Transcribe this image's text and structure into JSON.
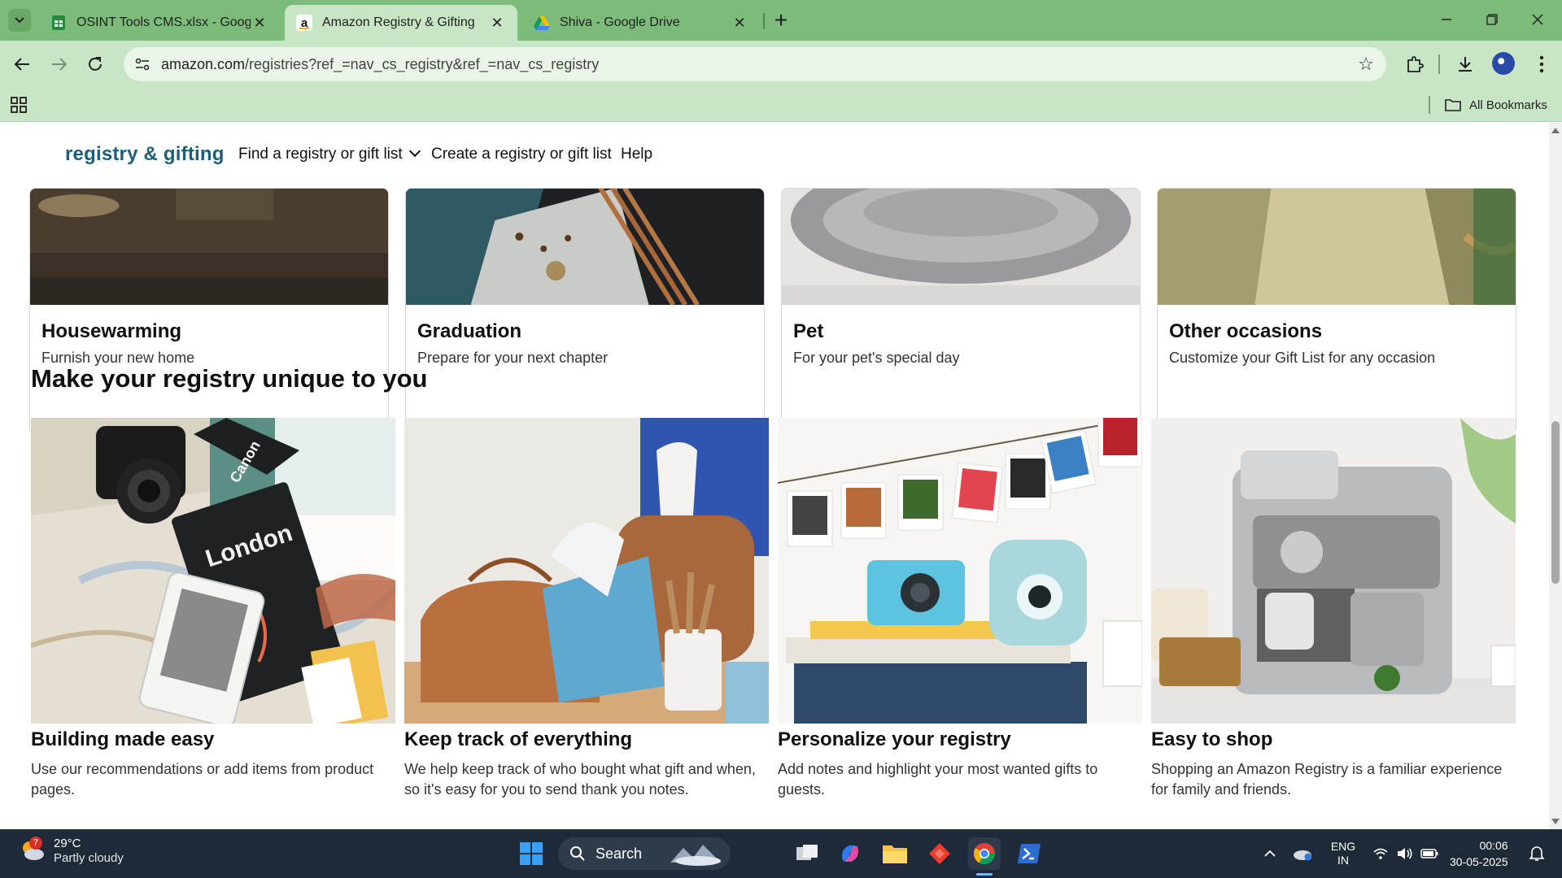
{
  "browser": {
    "tabs": [
      {
        "title": "OSINT Tools CMS.xlsx - Google",
        "icon": "sheets-icon"
      },
      {
        "title": "Amazon Registry & Gifting",
        "icon": "amazon-icon"
      },
      {
        "title": "Shiva - Google Drive",
        "icon": "drive-icon"
      }
    ],
    "url_host": "amazon.com",
    "url_path": "/registries?ref_=nav_cs_registry&ref_=nav_cs_registry",
    "all_bookmarks": "All Bookmarks"
  },
  "subnav": {
    "brand": "registry & gifting",
    "find": "Find a registry or gift list",
    "create": "Create a registry or gift list",
    "help": "Help"
  },
  "occasions": [
    {
      "name": "Housewarming",
      "desc": "Furnish your new home"
    },
    {
      "name": "Graduation",
      "desc": "Prepare for your next chapter"
    },
    {
      "name": "Pet",
      "desc": "For your pet's special day"
    },
    {
      "name": "Other occasions",
      "desc": "Customize your Gift List for any occasion"
    }
  ],
  "unique": {
    "title": "Make your registry unique to you",
    "features": [
      {
        "title": "Building made easy",
        "desc": "Use our recommendations or add items from product pages."
      },
      {
        "title": "Keep track of everything",
        "desc": "We help keep track of who bought what gift and when, so it's easy for you to send thank you notes."
      },
      {
        "title": "Personalize your registry",
        "desc": "Add notes and highlight your most wanted gifts to guests."
      },
      {
        "title": "Easy to shop",
        "desc": "Shopping an Amazon Registry is a familiar experience for family and friends."
      }
    ]
  },
  "photo_text": {
    "camera_brand": "Canon",
    "book_title": "London"
  },
  "taskbar": {
    "weather_badge": "7",
    "temp": "29°C",
    "condition": "Partly cloudy",
    "search": "Search",
    "lang_top": "ENG",
    "lang_bottom": "IN",
    "time": "00:06",
    "date": "30-05-2025"
  },
  "colors": {
    "tab_strip": "#7dbb7b",
    "toolbar": "#c8e6c5",
    "brand": "#1c5e7a",
    "taskbar": "#1e2a38"
  }
}
